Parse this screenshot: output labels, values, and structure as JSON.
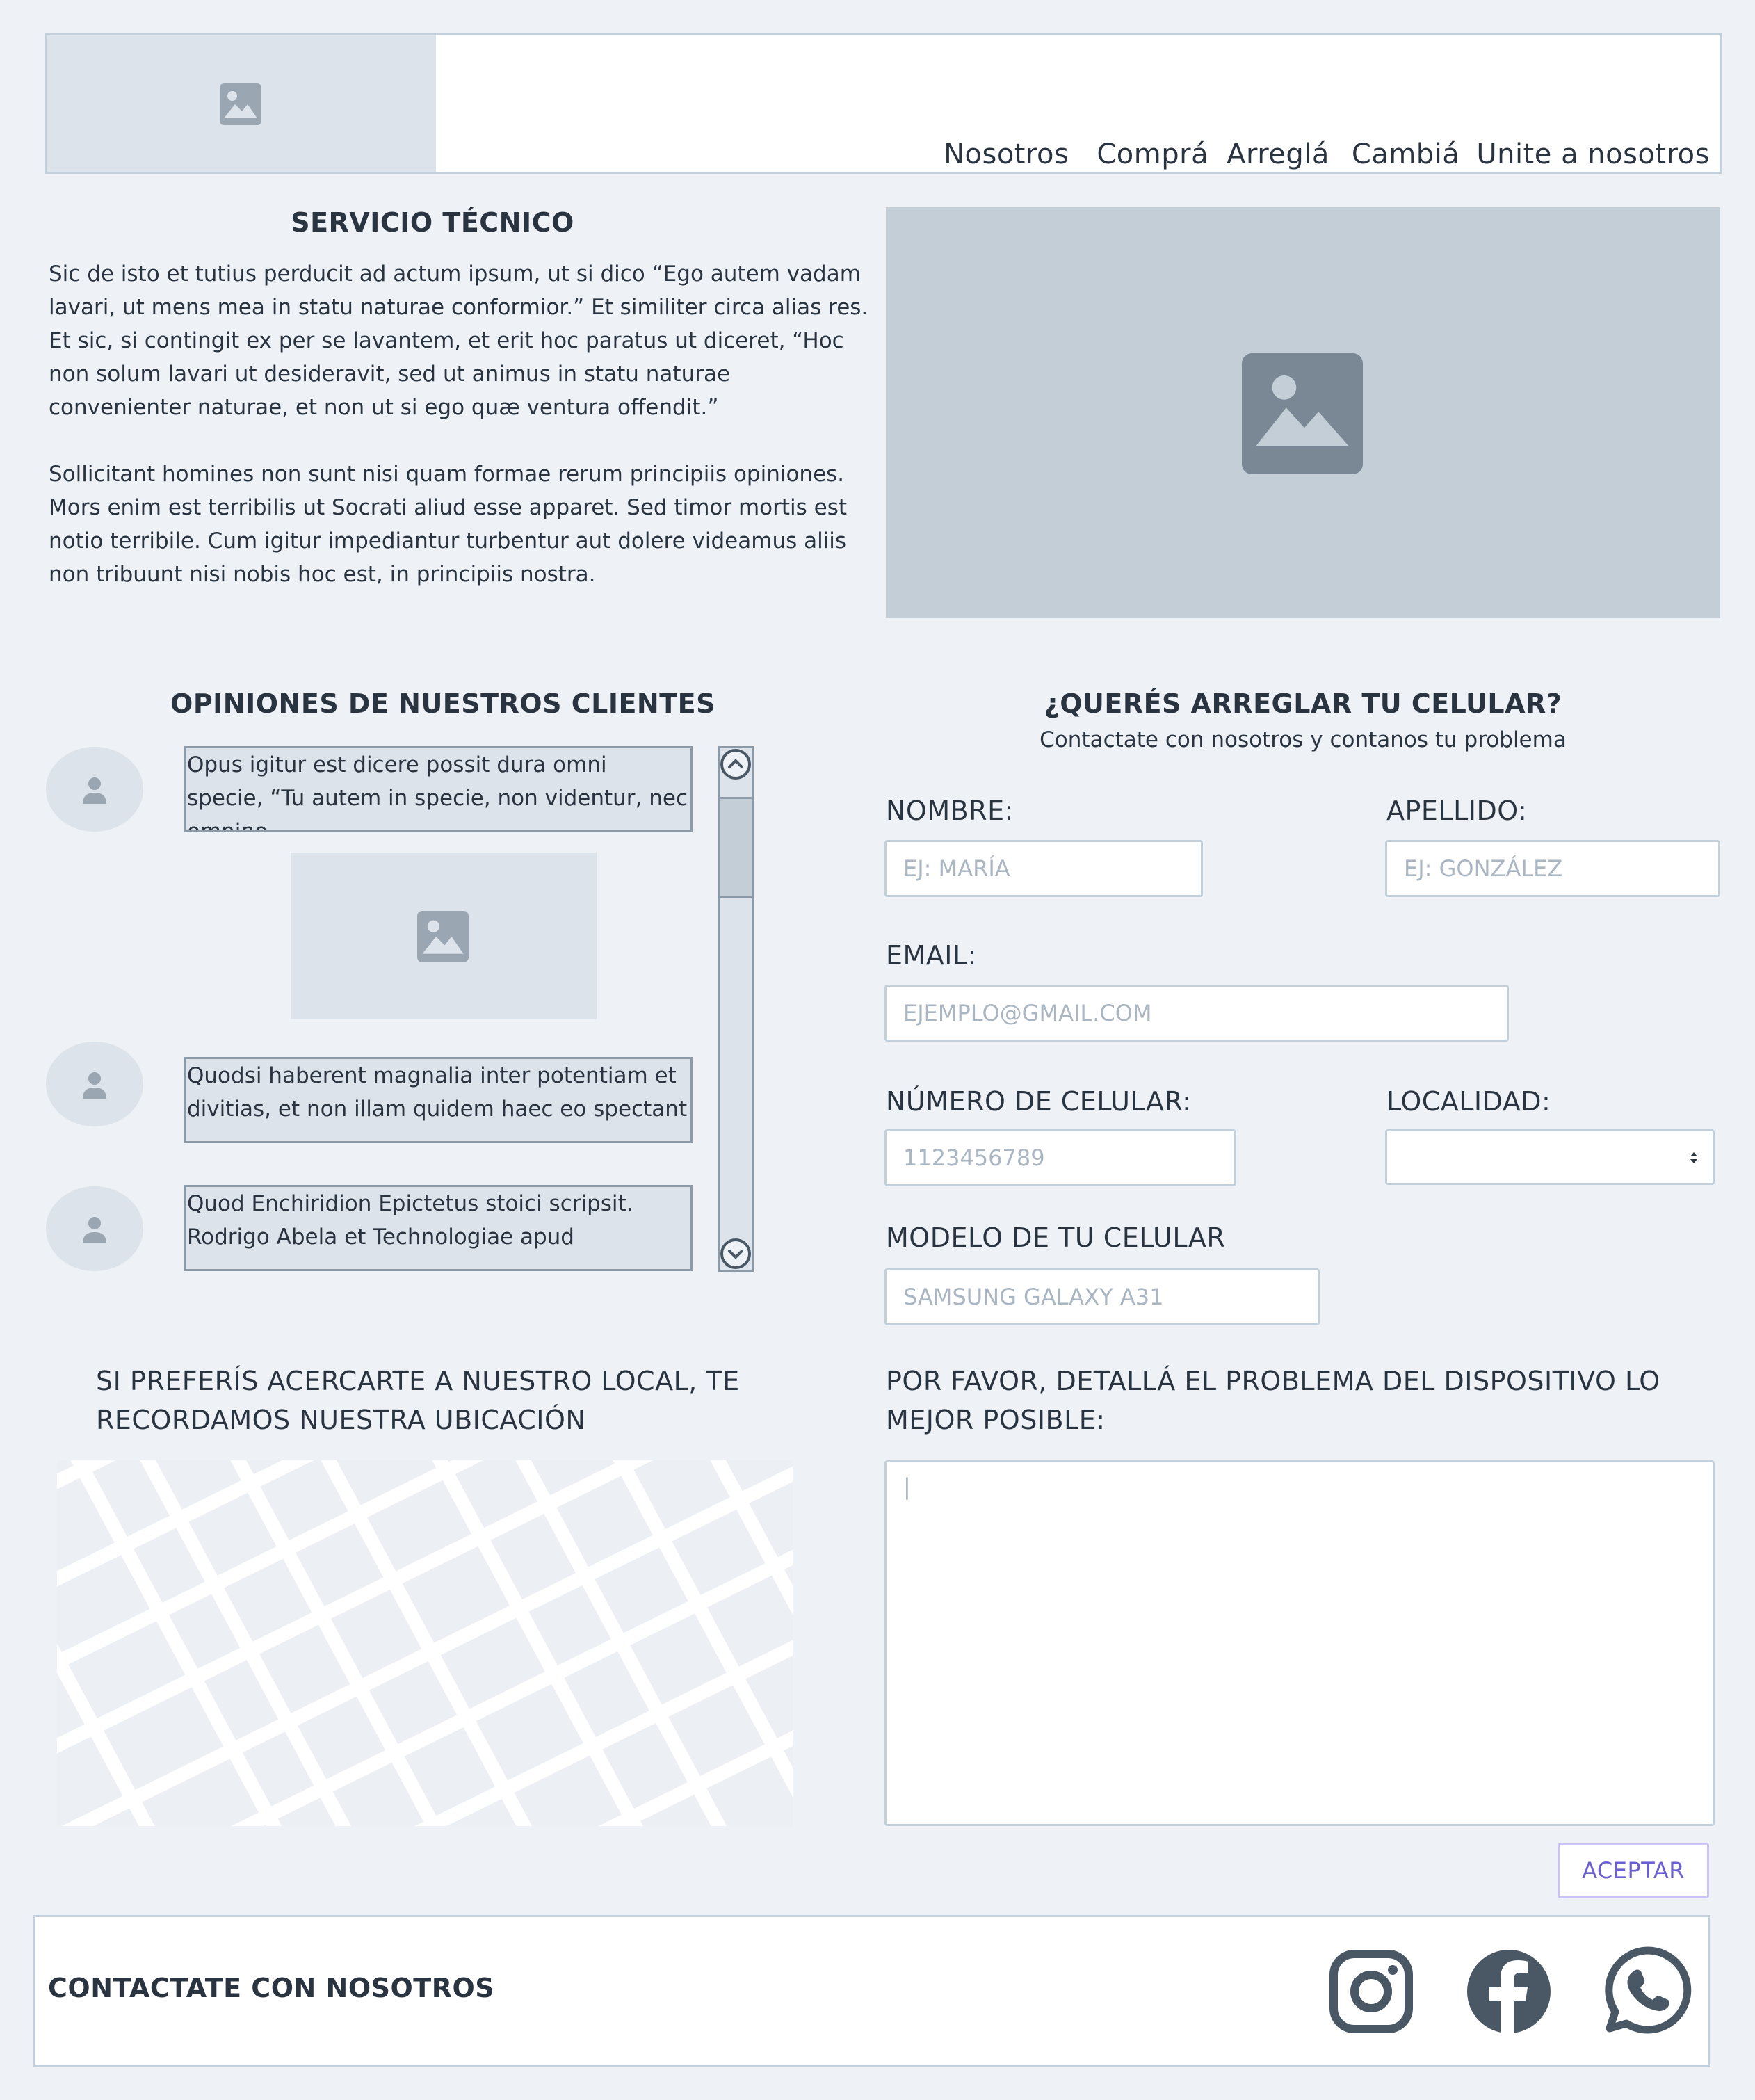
{
  "nav": {
    "items": [
      "Nosotros",
      "Comprá",
      "Arreglá",
      "Cambiá",
      "Unite a nosotros"
    ]
  },
  "servicio": {
    "title": "SERVICIO TÉCNICO",
    "paragraph1": "Sic de isto et tutius perducit ad actum ipsum, ut si dico “Ego autem vadam lavari, ut mens mea in statu naturae conformior.” Et similiter circa alias res. Et sic, si contingit ex per se lavantem, et erit hoc paratus ut diceret, “Hoc non solum lavari ut desideravit, sed ut animus in statu naturae convenienter naturae, et non ut si ego quæ ventura offendit.”",
    "paragraph2": "Sollicitant homines non sunt nisi quam formae rerum principiis opiniones. Mors enim est terribilis ut Socrati aliud esse apparet. Sed timor mortis est notio terribile. Cum igitur impediantur turbentur aut dolere videamus aliis non tribuunt nisi nobis hoc est, in principiis nostra."
  },
  "opiniones": {
    "title": "OPINIONES DE NUESTROS CLIENTES",
    "items": [
      {
        "text": "Opus igitur est dicere possit dura omni specie, “Tu autem in specie, non videntur, nec omnino"
      },
      {
        "text": "Quodsi haberent magnalia inter potentiam et divitias, et non illam quidem haec eo spectant"
      },
      {
        "text": "Quod Enchiridion Epictetus stoici scripsit. Rodrigo Abela et Technologiae apud"
      }
    ]
  },
  "form": {
    "title": "¿QUERÉS ARREGLAR TU CELULAR?",
    "subtitle": "Contactate con nosotros y contanos tu problema",
    "nombre": {
      "label": "NOMBRE:",
      "placeholder": "EJ: MARÍA"
    },
    "apellido": {
      "label": "APELLIDO:",
      "placeholder": "EJ: GONZÁLEZ"
    },
    "email": {
      "label": "EMAIL:",
      "placeholder": "EJEMPLO@GMAIL.COM"
    },
    "celular": {
      "label": "NÚMERO DE CELULAR:",
      "placeholder": "1123456789"
    },
    "localidad": {
      "label": "LOCALIDAD:",
      "value": ""
    },
    "modelo": {
      "label": "MODELO DE TU CELULAR",
      "placeholder": "SAMSUNG GALAXY A31"
    },
    "problema": {
      "label": "POR FAVOR, DETALLÁ EL PROBLEMA DEL DISPOSITIVO LO MEJOR POSIBLE:",
      "value": "|"
    },
    "submit_label": "ACEPTAR"
  },
  "ubicacion": {
    "text": "SI PREFERÍS ACERCARTE A NUESTRO LOCAL, TE RECORDAMOS NUESTRA UBICACIÓN"
  },
  "footer": {
    "title": "CONTACTATE CON NOSOTROS",
    "icons": [
      "instagram-icon",
      "facebook-icon",
      "whatsapp-icon"
    ]
  },
  "colors": {
    "page_bg": "#eef2f6",
    "placeholder_bg": "#dde3eb",
    "hero_bg": "#c3ced7",
    "text": "#2a3440",
    "icon": "#4a5866",
    "accent": "#6b5fd4"
  }
}
